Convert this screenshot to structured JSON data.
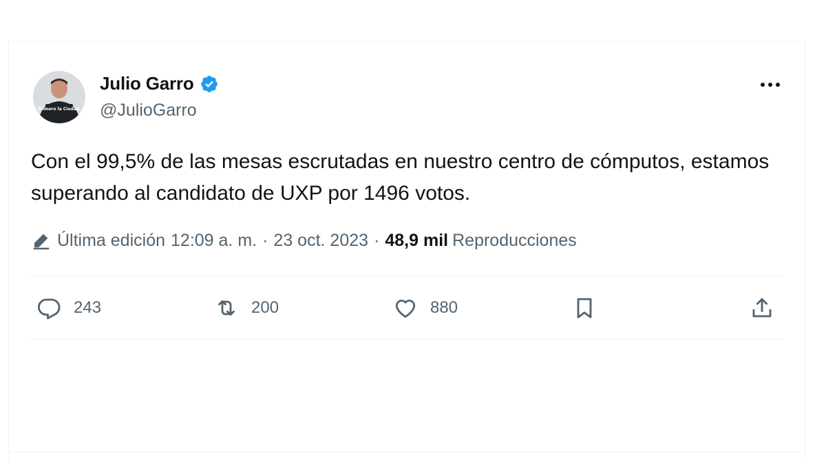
{
  "author": {
    "name": "Julio Garro",
    "handle": "@JulioGarro",
    "avatar_text": "Primero la Ciudad."
  },
  "tweet": {
    "text": "Con el 99,5% de las mesas escrutadas en nuestro centro de cómputos, estamos superando al candidato de UXP por 1496 votos.",
    "edited_label": "Última edición",
    "time": "12:09 a. m.",
    "separator": "·",
    "date": "23 oct. 2023",
    "views_count": "48,9 mil",
    "views_label": "Reproducciones"
  },
  "actions": {
    "replies": "243",
    "reposts": "200",
    "likes": "880"
  },
  "icons": {
    "more": "more-icon",
    "verified": "verified-badge-icon",
    "edit": "pencil-icon",
    "reply": "reply-icon",
    "repost": "repost-icon",
    "like": "heart-icon",
    "bookmark": "bookmark-icon",
    "share": "share-icon"
  },
  "colors": {
    "verified_blue": "#1d9bf0",
    "text_primary": "#0f1419",
    "text_secondary": "#536471",
    "divider": "#eff3f4"
  }
}
